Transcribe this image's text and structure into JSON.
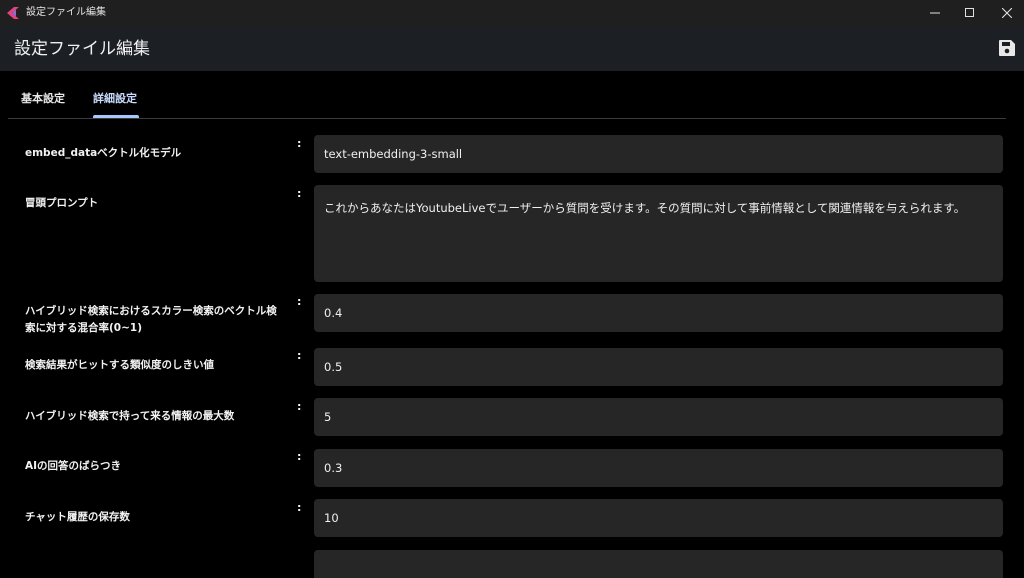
{
  "window": {
    "title": "設定ファイル編集",
    "accent_color": "#e0457b"
  },
  "appbar": {
    "title": "設定ファイル編集",
    "save_icon": "save-icon"
  },
  "tabs": [
    {
      "label": "基本設定",
      "selected": false
    },
    {
      "label": "詳細設定",
      "selected": true
    }
  ],
  "form": {
    "colon": ":",
    "rows": [
      {
        "label": "embed_dataベクトル化モデル",
        "value": "text-embedding-3-small"
      },
      {
        "label": "冒頭プロンプト",
        "value": "これからあなたはYoutubeLiveでユーザーから質問を受けます。その質問に対して事前情報として関連情報を与えられます。"
      },
      {
        "label": "ハイブリッド検索におけるスカラー検索のベクトル検索に対する混合率(0~1)",
        "value": "0.4"
      },
      {
        "label": "検索結果がヒットする類似度のしきい値",
        "value": "0.5"
      },
      {
        "label": "ハイブリッド検索で持って来る情報の最大数",
        "value": "5"
      },
      {
        "label": "AIの回答のばらつき",
        "value": "0.3"
      },
      {
        "label": "チャット履歴の保存数",
        "value": "10"
      },
      {
        "label": "",
        "value": ""
      }
    ]
  }
}
